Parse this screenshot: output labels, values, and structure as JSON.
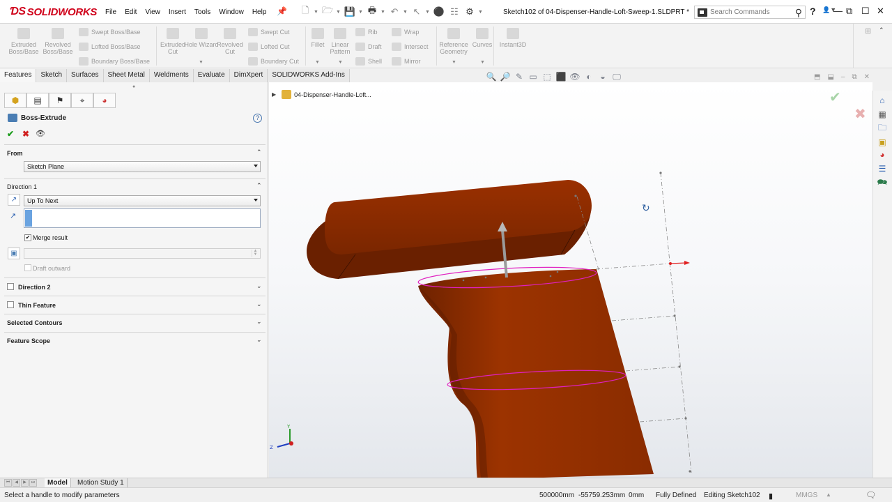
{
  "app": {
    "logo_text": "SOLIDWORKS",
    "document_title": "Sketch102 of 04-Dispenser-Handle-Loft-Sweep-1.SLDPRT *"
  },
  "menu": [
    "File",
    "Edit",
    "View",
    "Insert",
    "Tools",
    "Window",
    "Help"
  ],
  "search": {
    "placeholder": "Search Commands"
  },
  "help_icon": "?",
  "command_manager": {
    "extruded_boss": "Extruded Boss/Base",
    "revolved_boss": "Revolved Boss/Base",
    "swept_boss": "Swept Boss/Base",
    "lofted_boss": "Lofted Boss/Base",
    "boundary_boss": "Boundary Boss/Base",
    "extruded_cut": "Extruded Cut",
    "hole_wizard": "Hole Wizard",
    "revolved_cut": "Revolved Cut",
    "swept_cut": "Swept Cut",
    "lofted_cut": "Lofted Cut",
    "boundary_cut": "Boundary Cut",
    "fillet": "Fillet",
    "linear_pattern": "Linear Pattern",
    "rib": "Rib",
    "draft": "Draft",
    "shell": "Shell",
    "wrap": "Wrap",
    "intersect": "Intersect",
    "mirror": "Mirror",
    "reference_geometry": "Reference Geometry",
    "curves": "Curves",
    "instant3d": "Instant3D"
  },
  "tabs": [
    "Features",
    "Sketch",
    "Surfaces",
    "Sheet Metal",
    "Weldments",
    "Evaluate",
    "DimXpert",
    "SOLIDWORKS Add-Ins"
  ],
  "property_manager": {
    "title": "Boss-Extrude",
    "help": "?",
    "ok": "✔",
    "cancel": "✖",
    "preview": "👁",
    "from": {
      "label": "From",
      "value": "Sketch Plane"
    },
    "direction1": {
      "label": "Direction 1",
      "end_condition": "Up To Next",
      "depth": "",
      "merge_result_label": "Merge result",
      "merge_result_checked": true,
      "draft_outward_label": "Draft outward",
      "draft_outward_checked": false
    },
    "direction2": {
      "label": "Direction 2",
      "checked": false
    },
    "thin_feature": {
      "label": "Thin Feature",
      "checked": false
    },
    "selected_contours": {
      "label": "Selected Contours"
    },
    "feature_scope": {
      "label": "Feature Scope"
    }
  },
  "feature_tree": {
    "root": "04-Dispenser-Handle-Loft..."
  },
  "bottom_tabs": {
    "model": "Model",
    "motion_study": "Motion Study 1"
  },
  "status": {
    "message": "Select a handle to modify parameters",
    "x": "500000mm",
    "y": "-55759.253mm",
    "z": "0mm",
    "sketch_state": "Fully Defined",
    "editing": "Editing Sketch102",
    "units": "MMGS"
  },
  "colors": {
    "model": "#8b2a00",
    "model_dark": "#5e1c00",
    "sketch_highlight": "#e020c0",
    "logo_red": "#d0021b"
  }
}
